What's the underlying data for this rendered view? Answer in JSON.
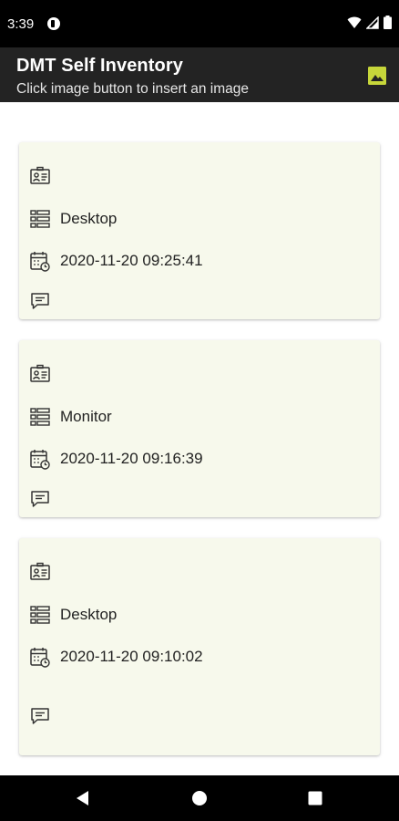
{
  "status_bar": {
    "time": "3:39"
  },
  "app_bar": {
    "title": "DMT Self Inventory",
    "subtitle": "Click image button to insert an image",
    "image_button_icon": "image-icon",
    "accent_color": "#c6d63a"
  },
  "cards": [
    {
      "name": "",
      "category": "Desktop",
      "datetime": "2020-11-20 09:25:41",
      "comment": ""
    },
    {
      "name": "",
      "category": "Monitor",
      "datetime": "2020-11-20 09:16:39",
      "comment": ""
    },
    {
      "name": "",
      "category": "Desktop",
      "datetime": "2020-11-20 09:10:02",
      "comment": ""
    }
  ],
  "icons": {
    "name": "id-card-icon",
    "category": "list-icon",
    "datetime": "calendar-clock-icon",
    "comment": "comment-icon"
  },
  "colors": {
    "card_background": "#f7f9ec",
    "app_bar": "#232323"
  },
  "nav": [
    "back-icon",
    "home-icon",
    "recents-icon"
  ]
}
